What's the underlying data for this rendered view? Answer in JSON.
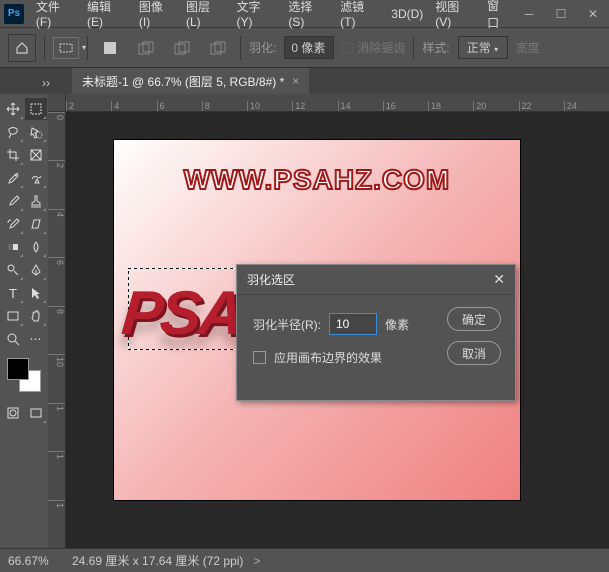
{
  "logo": "Ps",
  "menu": {
    "file": "文件(F)",
    "edit": "编辑(E)",
    "image": "图像(I)",
    "layer": "图层(L)",
    "type": "文字(Y)",
    "select": "选择(S)",
    "filter": "滤镜(T)",
    "threeD": "3D(D)",
    "view": "视图(V)",
    "window": "窗口"
  },
  "options": {
    "feather_label": "羽化:",
    "feather_value": "0 像素",
    "antialias": "消除锯齿",
    "style_label": "样式:",
    "style_value": "正常",
    "width_label": "宽度"
  },
  "tab": {
    "title": "未标题-1 @ 66.7% (图层 5, RGB/8#) *"
  },
  "ruler_h": [
    "2",
    "4",
    "6",
    "8",
    "10",
    "12",
    "14",
    "16",
    "18",
    "20",
    "22",
    "24"
  ],
  "ruler_v": [
    "0",
    "2",
    "4",
    "6",
    "8",
    "10",
    "1",
    "1",
    "1"
  ],
  "canvas": {
    "text1": "WWW.PSAHZ.COM",
    "text2": "PSAHZ"
  },
  "dialog": {
    "title": "羽化选区",
    "radius_label": "羽化半径(R):",
    "radius_value": "10",
    "unit": "像素",
    "apply_canvas": "应用画布边界的效果",
    "ok": "确定",
    "cancel": "取消"
  },
  "status": {
    "zoom": "66.67%",
    "info": "24.69 厘米 x 17.64 厘米 (72 ppi)",
    "arrow": ">"
  }
}
